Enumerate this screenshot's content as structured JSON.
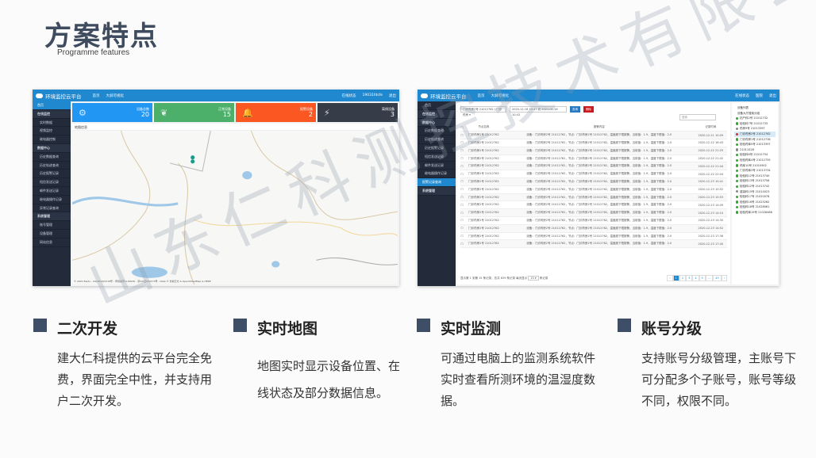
{
  "slide": {
    "title": "方案特点",
    "subtitle": "Programme features",
    "watermark": "山东仁科测控技术有限公司"
  },
  "app": {
    "name": "环境监控云平台",
    "nav": [
      "首页",
      "大屏可视化"
    ],
    "status": "在线状态",
    "user": "19031fdsfe",
    "user2": "医院",
    "logout": "退出"
  },
  "shot1": {
    "sidebar": [
      {
        "label": "首页",
        "type": "act"
      },
      {
        "label": "在线监控",
        "type": "grp"
      },
      {
        "label": "实时数据"
      },
      {
        "label": "视频监控"
      },
      {
        "label": "继电器控制"
      },
      {
        "label": "数据中心",
        "type": "grp"
      },
      {
        "label": "历史数据查询"
      },
      {
        "label": "历史轨迹查询"
      },
      {
        "label": "历史报警记录"
      },
      {
        "label": "短信发送记录"
      },
      {
        "label": "邮件发送记录"
      },
      {
        "label": "继电器操作记录"
      },
      {
        "label": "异常记录查询"
      },
      {
        "label": "系统管理",
        "type": "grp"
      },
      {
        "label": "账号管理"
      },
      {
        "label": "设备管理"
      },
      {
        "label": "网站信息"
      }
    ],
    "cards": [
      {
        "label": "设备总数",
        "value": "20",
        "color": "#2196f3",
        "icon": "⚙"
      },
      {
        "label": "正常设备",
        "value": "15",
        "color": "#4caf6a",
        "icon": "❦"
      },
      {
        "label": "报警设备",
        "value": "2",
        "color": "#fb5722",
        "icon": "🔔"
      },
      {
        "label": "离线设备",
        "value": "3",
        "color": "#363d49",
        "icon": "⚡"
      }
    ],
    "map_title": "地图信息",
    "map_footer": "© 2021 Baidu - GS(2019)5218号 - 甲测资字1100930 - 京ICP证030173号 - Data © 长地万方 & OpenStreetMap & HERE"
  },
  "shot2": {
    "sidebar": [
      {
        "label": "首页"
      },
      {
        "label": "在线监控",
        "type": "grp"
      },
      {
        "label": "数据中心",
        "type": "grp"
      },
      {
        "label": "历史数据查询"
      },
      {
        "label": "历史轨迹查询"
      },
      {
        "label": "历史报警记录"
      },
      {
        "label": "短信发送记录"
      },
      {
        "label": "邮件发送记录"
      },
      {
        "label": "继电器操作记录"
      },
      {
        "label": "报警记录查询",
        "type": "act"
      },
      {
        "label": "系统管理",
        "type": "grp"
      }
    ],
    "filter": {
      "device": "门诊药房2号 21012762 / 门诊药房 ▾",
      "range": "2020-12-16 10:43 到 2021-01-16 10:43",
      "query": "查询",
      "delete": "删除",
      "search_placeholder": "搜索"
    },
    "columns": [
      "节点名称",
      "报警内容",
      "记录时间"
    ],
    "node": "门诊药房2号 21012762",
    "content": "设备：门诊药房2号 21012762，节点：门诊药房2号 21012762，温度超下限报警，当前值：1.9，温度下限值：2.0",
    "times": [
      "2020-12-21 10:09",
      "2020-12-22 16:43",
      "2020-12-22 21:25",
      "2020-12-22 21:42",
      "2020-12-22 21:44",
      "2020-12-22 22:04",
      "2020-12-23 10:41",
      "2020-12-23 10:52",
      "2020-12-23 10:53",
      "2020-12-23 14:09",
      "2020-12-23 14:10",
      "2020-12-23 14:30",
      "2020-12-23 14:52",
      "2020-12-23 17:36",
      "2020-12-23 17:40"
    ],
    "pagination": {
      "summary": "显示第 1 到第 15 条记录，总共 639 条记录 每页显示",
      "per_page": "15 ▾",
      "suffix": "条记录",
      "pages": [
        "‹",
        "1",
        "2",
        "3",
        "4",
        "5",
        "...",
        "43",
        "›"
      ],
      "current": "1"
    },
    "tree_title": "设备列表",
    "tree_root": "设备大厅搜索分组",
    "tree": [
      {
        "name": "妇产科2号 21012732",
        "status": "online"
      },
      {
        "name": "检验科7号 21012733",
        "status": "online"
      },
      {
        "name": "药房9号 21013397",
        "status": "offline"
      },
      {
        "name": "门诊药房2号 21012762",
        "status": "alarm"
      },
      {
        "name": "门诊药房1号 21012736",
        "status": "online"
      },
      {
        "name": "检验药库5号 21013397",
        "status": "online"
      },
      {
        "name": "21011028",
        "status": "offline"
      },
      {
        "name": "检验科6号 21012754",
        "status": "online"
      },
      {
        "name": "检验药库4号 21012755",
        "status": "online"
      },
      {
        "name": "药库10号 21010902",
        "status": "online"
      },
      {
        "name": "门诊药库3号 21013734",
        "status": "online"
      },
      {
        "name": "检验科12号 21013740",
        "status": "online"
      },
      {
        "name": "检验科13号 21013756",
        "status": "online"
      },
      {
        "name": "检验科12号 21013742",
        "status": "online"
      },
      {
        "name": "感染科15号 21014023",
        "status": "offline"
      },
      {
        "name": "检验科17号 21020076",
        "status": "online"
      },
      {
        "name": "检验科16号 21025262",
        "status": "online"
      },
      {
        "name": "检验科18号 21028061",
        "status": "online"
      },
      {
        "name": "检验药库19号 21028466",
        "status": "online"
      }
    ],
    "status_colors": {
      "online": "#2ea82e",
      "offline": "#888888",
      "alarm": "#d0302a"
    }
  },
  "features": [
    {
      "title": "二次开发",
      "desc": "建大仁科提供的云平台完全免费，界面完全中性，并支持用户二次开发。"
    },
    {
      "title": "实时地图",
      "desc": "地图实时显示设备位置、在线状态及部分数据信息。"
    },
    {
      "title": "实时监测",
      "desc": "可通过电脑上的监测系统软件实时查看所测环境的温湿度数据。"
    },
    {
      "title": "账号分级",
      "desc": "支持账号分级管理，主账号下可分配多个子账号，账号等级不同，权限不同。"
    }
  ]
}
